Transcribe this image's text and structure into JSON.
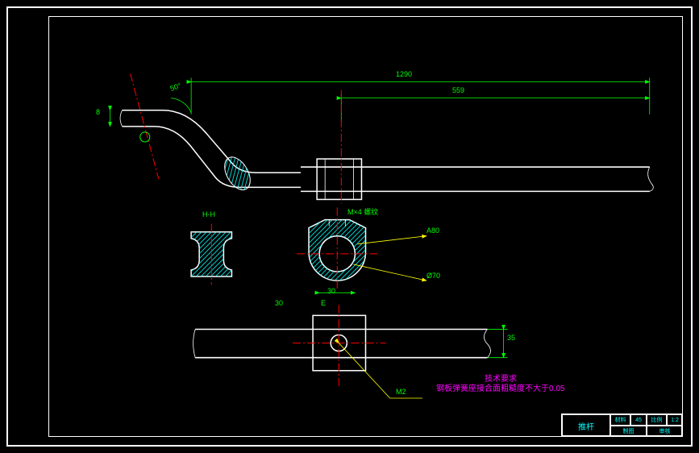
{
  "drawing": {
    "colors": {
      "background": "#000000",
      "border": "#ffffff",
      "outline": "#ffffff",
      "dimension": "#00ff00",
      "centerline": "#ff0000",
      "note": "#ff00ff",
      "leader": "#ffff00",
      "titleblock_text": "#00ffff"
    },
    "dimensions": {
      "top_overall": "1290",
      "top_sub": "559",
      "left_height": "8",
      "angle_left": "50°",
      "section_label": "H-H",
      "section_width": "30",
      "hole_label": "M×4 螺纹",
      "callout_a": "A80",
      "callout_b": "Ø70",
      "bottom_width": "35",
      "bottom_e": "E",
      "bottom_dia": "M2",
      "bottom_sub": "30"
    },
    "notes": {
      "title": "技术要求",
      "line1": "钢板弹簧座接合面粗糙度不大于0.05"
    },
    "titleblock": {
      "part_name": "推杆",
      "material_label": "材料",
      "material": "45",
      "scale_label": "比例",
      "scale": "1:2",
      "drawn_label": "制图",
      "checked_label": "审核"
    }
  },
  "chart_data": {
    "type": "table",
    "title": "CAD mechanical drawing — 推杆 (Push Rod)",
    "views": [
      {
        "name": "main-side-view",
        "notes": "bent rod with hatched section, overall length 1290, sub 559"
      },
      {
        "name": "section-H-H",
        "notes": "I-beam / channel cross section, width 30"
      },
      {
        "name": "boss-detail",
        "notes": "circular boss Ø70, hole M×4, callout A80"
      },
      {
        "name": "bottom-plan",
        "notes": "shaft with square boss, hole M2, width 35"
      }
    ],
    "technical_requirements": [
      "钢板弹簧座接合面粗糙度不大于0.05"
    ]
  }
}
